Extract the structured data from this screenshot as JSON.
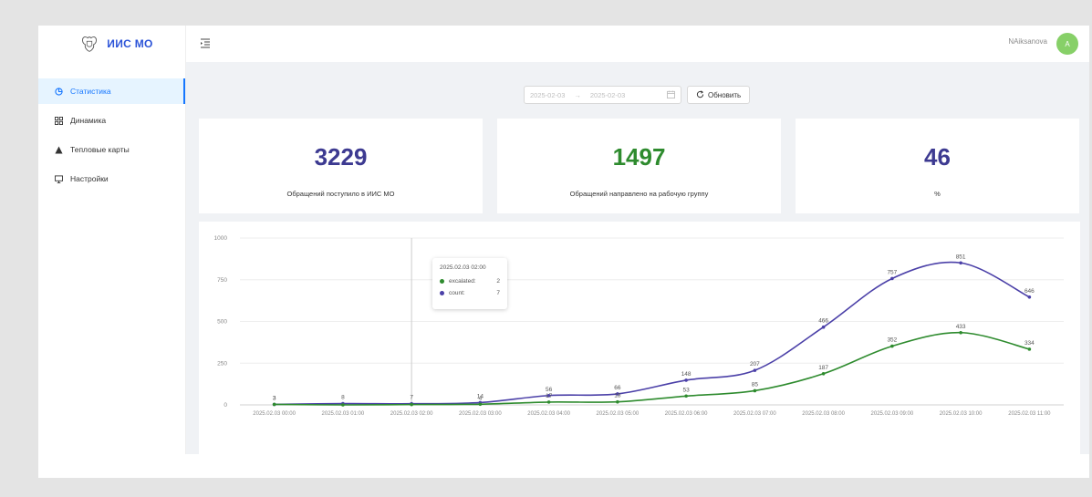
{
  "app": {
    "title": "ИИС МО"
  },
  "sidebar": {
    "items": [
      {
        "label": "Статистика",
        "icon": "pie-chart-icon",
        "active": true
      },
      {
        "label": "Динамика",
        "icon": "dashboard-grid-icon",
        "active": false
      },
      {
        "label": "Тепловые карты",
        "icon": "triangle-icon",
        "active": false
      },
      {
        "label": "Настройки",
        "icon": "monitor-icon",
        "active": false
      }
    ]
  },
  "header": {
    "user_name": "NAiksanova",
    "avatar_letter": "A",
    "avatar_color": "#87d068"
  },
  "filter": {
    "date_from": "2025-02-03",
    "date_to": "2025-02-03",
    "separator": "→",
    "refresh_label": "Обновить"
  },
  "cards": [
    {
      "value": "3229",
      "caption": "Обращений поступило в ИИС МО",
      "color": "#3d3a91"
    },
    {
      "value": "1497",
      "caption": "Обращений направлено на рабочую группу",
      "color": "#2e8b2e"
    },
    {
      "value": "46",
      "caption": "%",
      "color": "#3d3a91"
    }
  ],
  "tooltip": {
    "title": "2025.02.03 02:00",
    "rows": [
      {
        "label": "excalated:",
        "value": "2",
        "color": "#2e8b2e"
      },
      {
        "label": "count:",
        "value": "7",
        "color": "#4b40a8"
      }
    ]
  },
  "chart_data": {
    "type": "line",
    "x": [
      "2025.02.03 00:00",
      "2025.02.03 01:00",
      "2025.02.03 02:00",
      "2025.02.03 03:00",
      "2025.02.03 04:00",
      "2025.02.03 05:00",
      "2025.02.03 06:00",
      "2025.02.03 07:00",
      "2025.02.03 08:00",
      "2025.02.03 09:00",
      "2025.02.03 10:00",
      "2025.02.03 11:00"
    ],
    "series": [
      {
        "name": "count",
        "color": "#4b40a8",
        "values": [
          3,
          8,
          7,
          14,
          56,
          66,
          148,
          207,
          466,
          757,
          851,
          646
        ],
        "labels": [
          "3",
          "8",
          "7",
          "14",
          "56",
          "66",
          "148",
          "207",
          "466",
          "757",
          "851",
          "646"
        ]
      },
      {
        "name": "excalated",
        "color": "#2e8b2e",
        "values": [
          3,
          0,
          2,
          4,
          17,
          18,
          53,
          85,
          187,
          352,
          433,
          334
        ],
        "labels": [
          "3",
          "",
          "",
          "4",
          "17",
          "18",
          "53",
          "85",
          "187",
          "352",
          "433",
          "334"
        ]
      }
    ],
    "yticks": [
      0,
      250,
      500,
      750,
      1000
    ],
    "ylim": [
      0,
      1000
    ],
    "grid": true,
    "highlight_index": 2
  }
}
